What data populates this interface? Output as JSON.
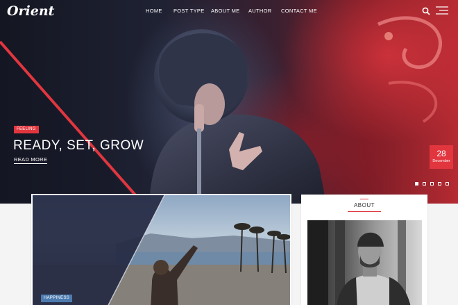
{
  "header": {
    "logo": "Orient",
    "nav": [
      {
        "label": "HOME"
      },
      {
        "label": "POST TYPE"
      },
      {
        "label": "ABOUT ME"
      },
      {
        "label": "AUTHOR"
      },
      {
        "label": "CONTACT ME"
      }
    ]
  },
  "hero": {
    "category": "FEELING",
    "title": "READY, SET, GROW",
    "read_more": "READ MORE",
    "date": {
      "day": "28",
      "month": "December"
    },
    "slides": 5,
    "active_slide": 1
  },
  "post": {
    "category": "HAPPINESS"
  },
  "sidebar": {
    "about_title": "ABOUT"
  },
  "colors": {
    "accent": "#e2363f",
    "post_tag": "#4d7bb0"
  },
  "icons": [
    "search-icon",
    "menu-icon"
  ]
}
